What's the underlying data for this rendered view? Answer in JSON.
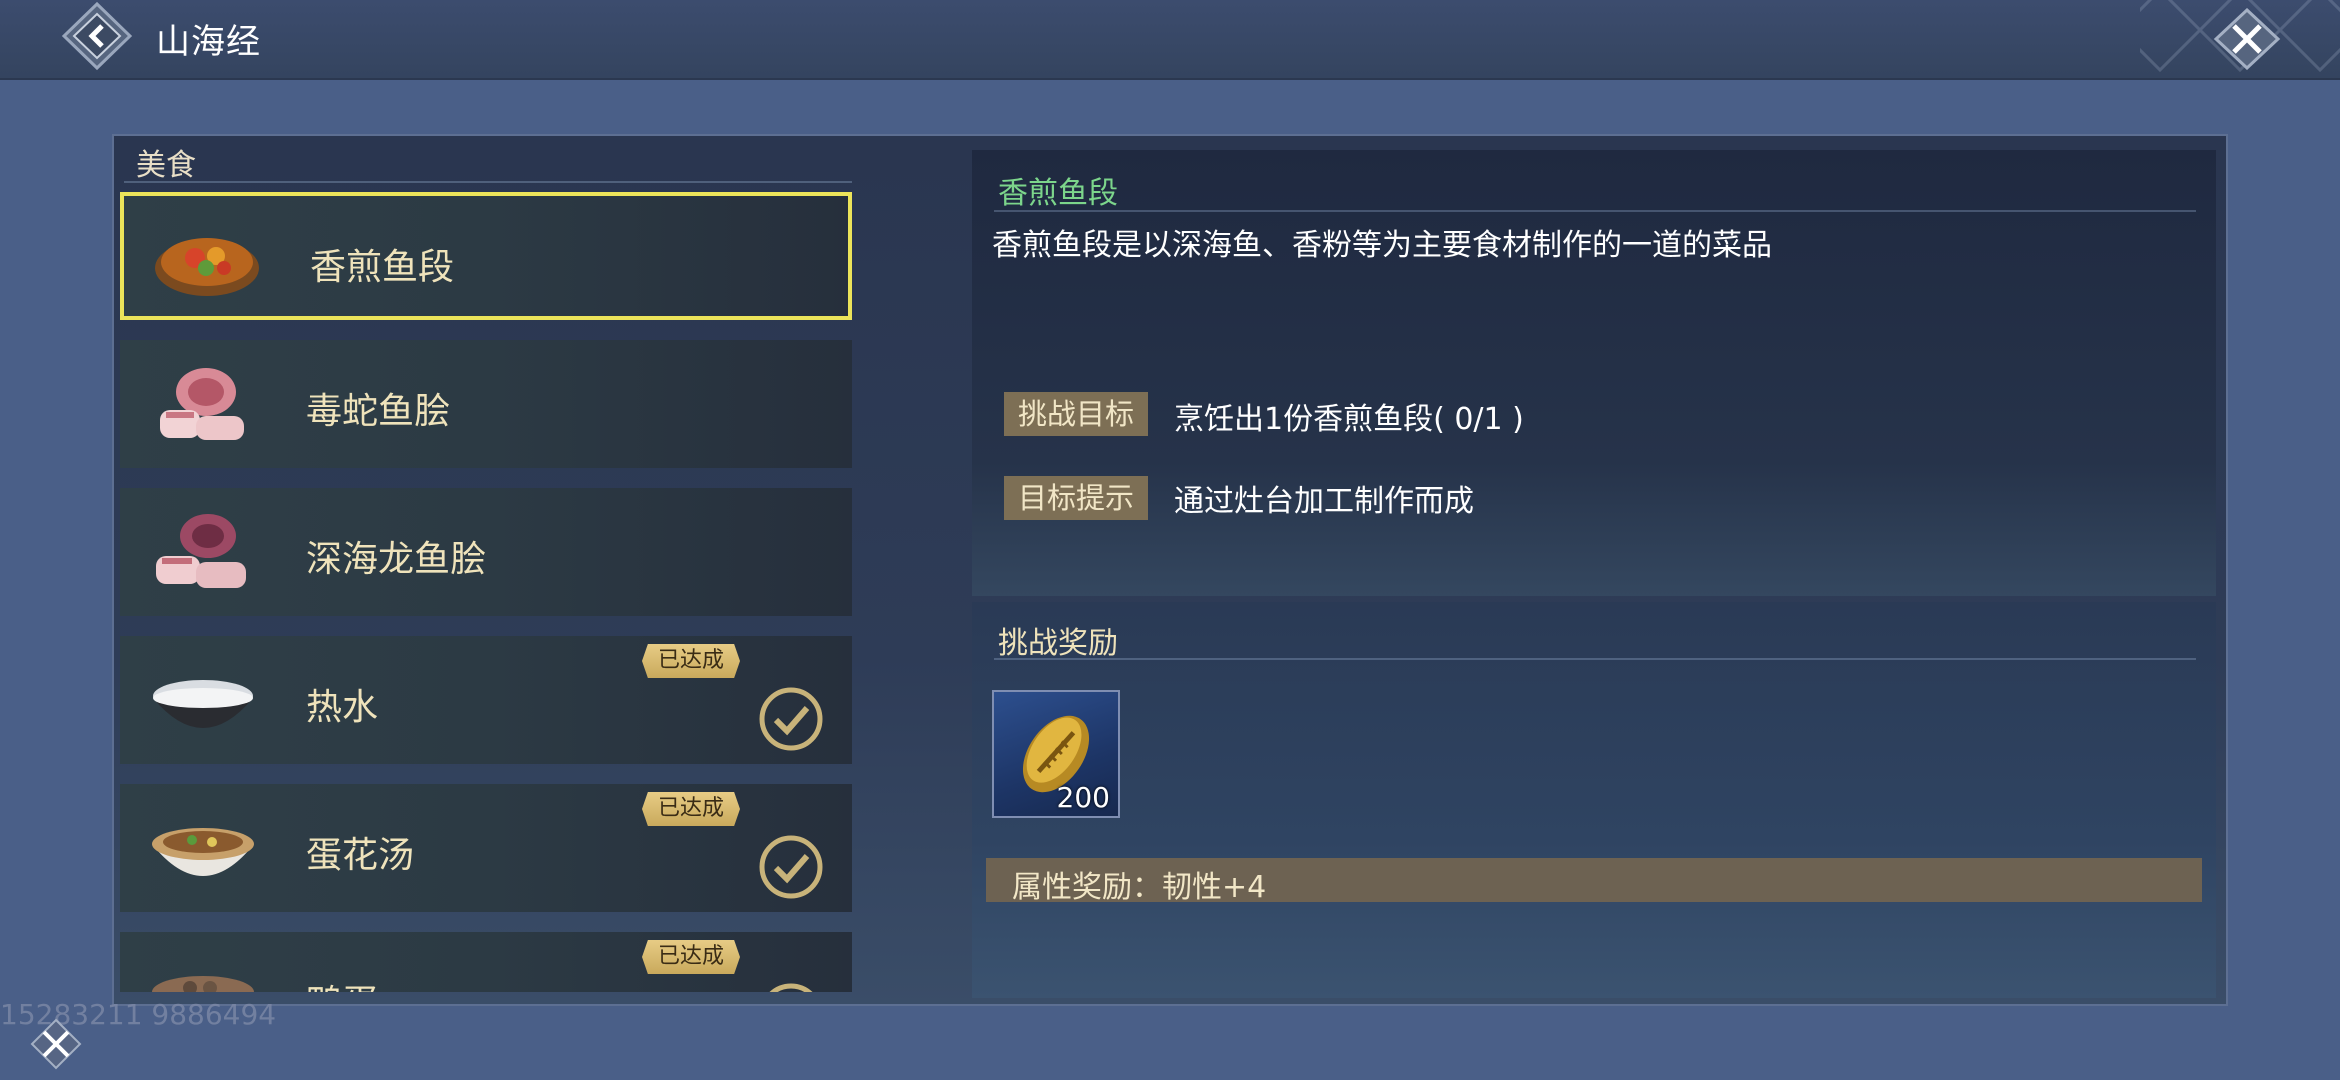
{
  "header": {
    "title": "山海经"
  },
  "left_panel": {
    "title": "美食",
    "items": [
      {
        "name": "香煎鱼段",
        "selected": true,
        "completed": false,
        "dish_icon": "grilled-fish-dish-icon"
      },
      {
        "name": "毒蛇鱼脍",
        "selected": false,
        "completed": false,
        "dish_icon": "sliced-fish-dish-icon"
      },
      {
        "name": "深海龙鱼脍",
        "selected": false,
        "completed": false,
        "dish_icon": "sliced-fish-dish-icon"
      },
      {
        "name": "热水",
        "selected": false,
        "completed": true,
        "badge": "已达成",
        "dish_icon": "rice-bowl-icon"
      },
      {
        "name": "蛋花汤",
        "selected": false,
        "completed": true,
        "badge": "已达成",
        "dish_icon": "soup-bowl-icon"
      },
      {
        "name": "鸭蛋",
        "selected": false,
        "completed": true,
        "badge": "已达成",
        "dish_icon": "dish-bowl-icon"
      }
    ]
  },
  "detail": {
    "title": "香煎鱼段",
    "description": "香煎鱼段是以深海鱼、香粉等为主要食材制作的一道的菜品",
    "challenge_label": "挑战目标",
    "challenge_text": "烹饪出1份香煎鱼段( 0/1 )",
    "hint_label": "目标提示",
    "hint_text": "通过灶台加工制作而成"
  },
  "rewards": {
    "title": "挑战奖励",
    "item": {
      "icon": "gold-shell-coin-icon",
      "count": "200"
    },
    "attribute_text": "属性奖励：韧性+4"
  },
  "footer": {
    "uid": "15283211 9886494"
  },
  "colors": {
    "accent_selected": "#ece45a",
    "detail_title": "#7cd58b",
    "badge": "#e7cc85",
    "tag_bg": "#7d6f55"
  }
}
